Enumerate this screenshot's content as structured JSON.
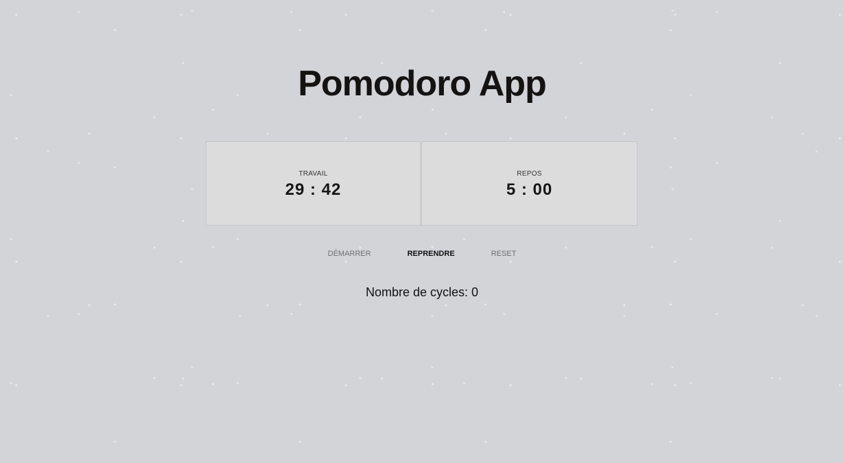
{
  "app": {
    "title": "Pomodoro App"
  },
  "timers": [
    {
      "label": "TRAVAIL",
      "value": "29 : 42"
    },
    {
      "label": "REPOS",
      "value": "5 : 00"
    }
  ],
  "controls": {
    "start_label": "DÉMARRER",
    "resume_label": "REPRENDRE",
    "reset_label": "RESET"
  },
  "cycles": {
    "text": "Nombre de cycles: 0"
  },
  "colors": {
    "background": "#d3d4d8",
    "panel": "#dcdcdc",
    "text": "#151212",
    "muted_button": "#6f6f6f"
  }
}
